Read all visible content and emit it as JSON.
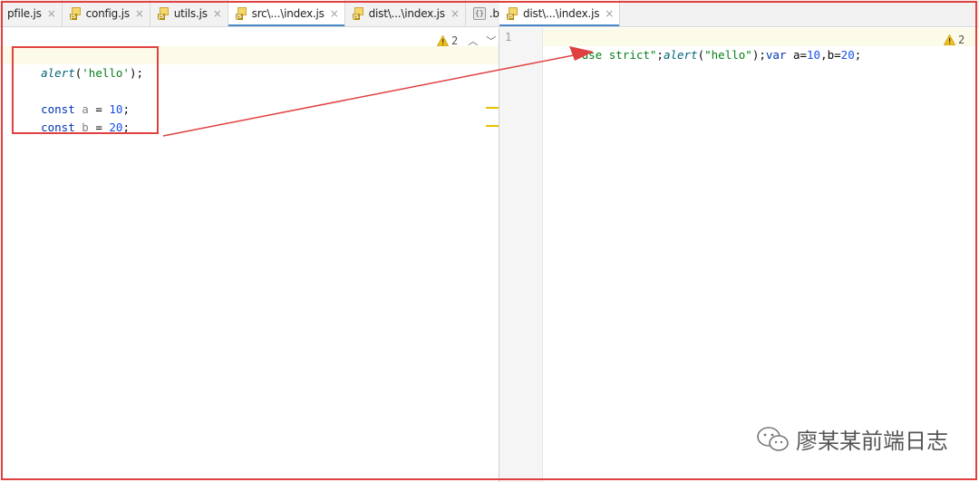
{
  "left_tabs": [
    {
      "label": "pfile.js",
      "icon": "js-file-icon",
      "active": false
    },
    {
      "label": "config.js",
      "icon": "js-file-icon",
      "active": false
    },
    {
      "label": "utils.js",
      "icon": "js-file-icon",
      "active": false
    },
    {
      "label": "src\\...\\index.js",
      "icon": "js-file-icon",
      "active": true
    },
    {
      "label": "dist\\...\\index.js",
      "icon": "js-file-icon",
      "active": false
    },
    {
      "label": ".babe",
      "icon": "config-file-icon",
      "active": false
    }
  ],
  "right_tabs": [
    {
      "label": "dist\\...\\index.js",
      "icon": "js-file-icon",
      "active": true
    }
  ],
  "tab_close_glyph": "×",
  "js_icon_label": "JS",
  "left_editor": {
    "warning_count": "2",
    "lines": [
      {
        "fn": "alert",
        "open": "(",
        "str": "'hello'",
        "close": ");"
      },
      {
        "kw": "const",
        "name": "a",
        "eq": " = ",
        "num": "10",
        "end": ";"
      },
      {
        "kw": "const",
        "name": "b",
        "eq": " = ",
        "num": "20",
        "end": ";"
      }
    ]
  },
  "right_editor": {
    "line_number": "1",
    "warning_count": "2",
    "code": {
      "str1": "\"use strict\"",
      "semi1": ";",
      "fn": "alert",
      "open": "(",
      "str2": "\"hello\"",
      "close": ");",
      "kw": "var",
      "rest_a": " a=",
      "num1": "10",
      "comma": ",b=",
      "num2": "20",
      "end": ";"
    }
  },
  "watermark": {
    "text": "廖某某前端日志"
  },
  "colors": {
    "annotation": "#e04040",
    "keyword": "#0033b3",
    "string": "#067d17",
    "number": "#1750eb",
    "active_tab_underline": "#4a88c7"
  }
}
